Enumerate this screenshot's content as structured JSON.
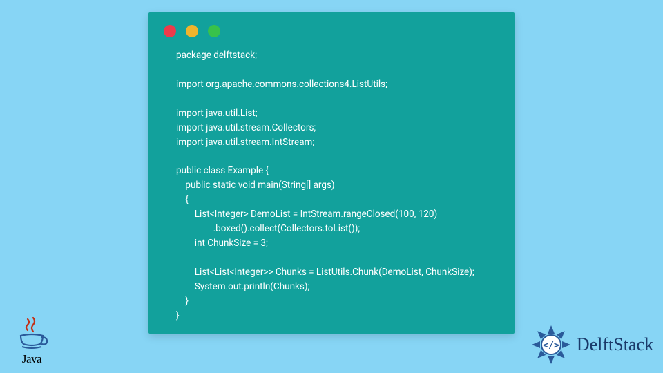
{
  "window": {
    "dots": [
      "close",
      "minimize",
      "maximize"
    ]
  },
  "code": {
    "lines": [
      "package delftstack;",
      "",
      "import org.apache.commons.collections4.ListUtils;",
      "",
      "import java.util.List;",
      "import java.util.stream.Collectors;",
      "import java.util.stream.IntStream;",
      "",
      "public class Example {",
      "    public static void main(String[] args)",
      "    {",
      "        List<Integer> DemoList = IntStream.rangeClosed(100, 120)",
      "                .boxed().collect(Collectors.toList());",
      "        int ChunkSize = 3;",
      "",
      "        List<List<Integer>> Chunks = ListUtils.Chunk(DemoList, ChunkSize);",
      "        System.out.println(Chunks);",
      "    }",
      "}"
    ]
  },
  "logos": {
    "java_label": "Java",
    "delft_label": "DelftStack"
  },
  "colors": {
    "background": "#87d5f5",
    "window": "#12a19c",
    "code_text": "#ffffff",
    "dot_red": "#ed3b4b",
    "dot_yellow": "#f0b42c",
    "dot_green": "#38c24a",
    "java_red": "#c23016",
    "delft_blue": "#1a3a6a"
  }
}
